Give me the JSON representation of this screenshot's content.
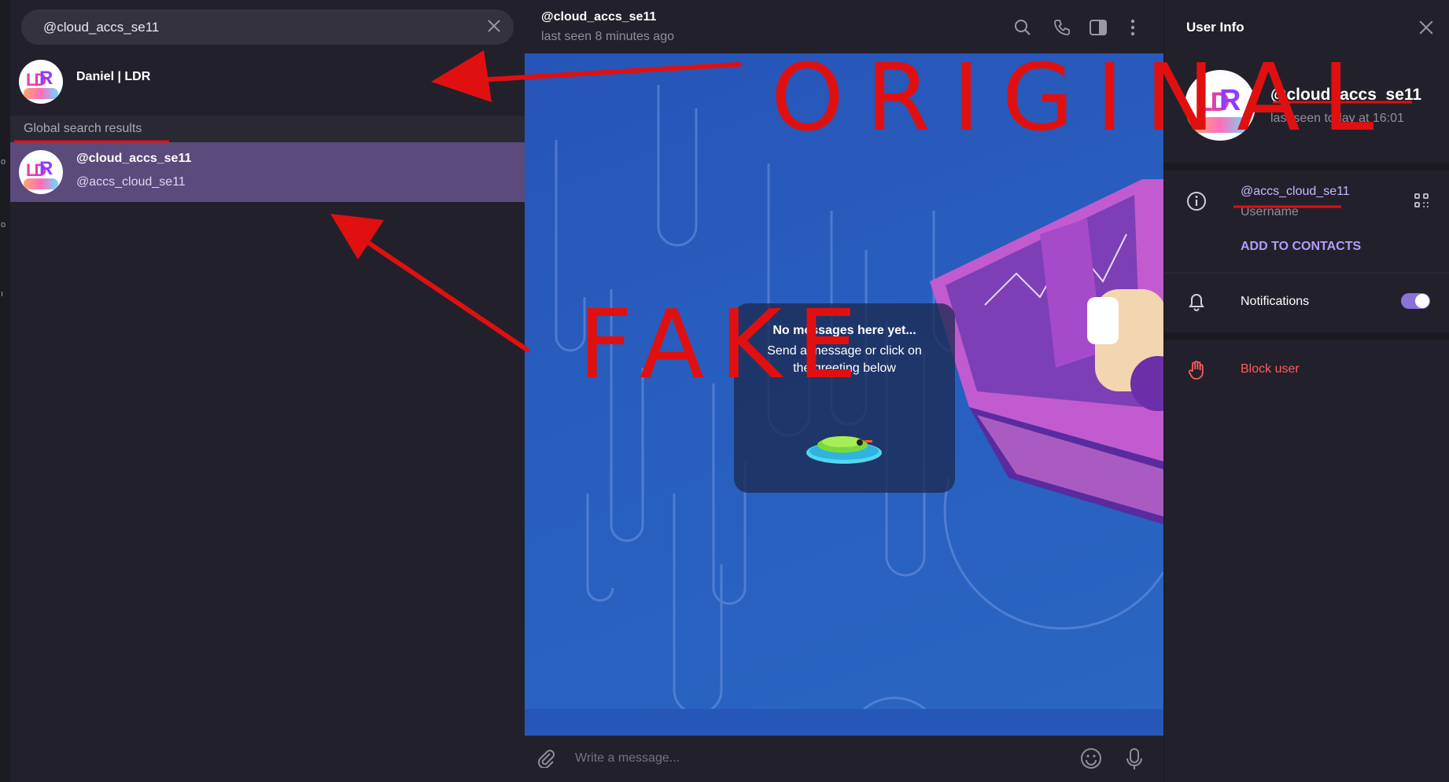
{
  "search": {
    "value": "@cloud_accs_se11"
  },
  "chat_list": {
    "top_result": {
      "name": "Daniel | LDR"
    },
    "section_label": "Global search results",
    "global_result": {
      "name": "@cloud_accs_se11",
      "username": "@accs_cloud_se11"
    }
  },
  "chat": {
    "title": "@cloud_accs_se11",
    "status": "last seen 8 minutes ago",
    "empty_title": "No messages here yet...",
    "empty_text": "Send a message or click on the greeting below",
    "composer_placeholder": "Write a message..."
  },
  "user_info": {
    "title": "User Info",
    "name": "@cloud_accs_se11",
    "last_seen": "last seen today at 16:01",
    "username": "@accs_cloud_se11",
    "username_label": "Username",
    "add_contacts": "ADD TO CONTACTS",
    "notifications": "Notifications",
    "notifications_on": true,
    "block": "Block user"
  },
  "avatar_text": {
    "left": "LD",
    "right": "R"
  },
  "annotations": {
    "word1": "ORIGINAL",
    "word2": "FAKE"
  },
  "colors": {
    "accent": "#8a72d8",
    "danger": "#ff5a5f",
    "selected_row": "#5b4a7c",
    "annotation": "#e01010"
  }
}
